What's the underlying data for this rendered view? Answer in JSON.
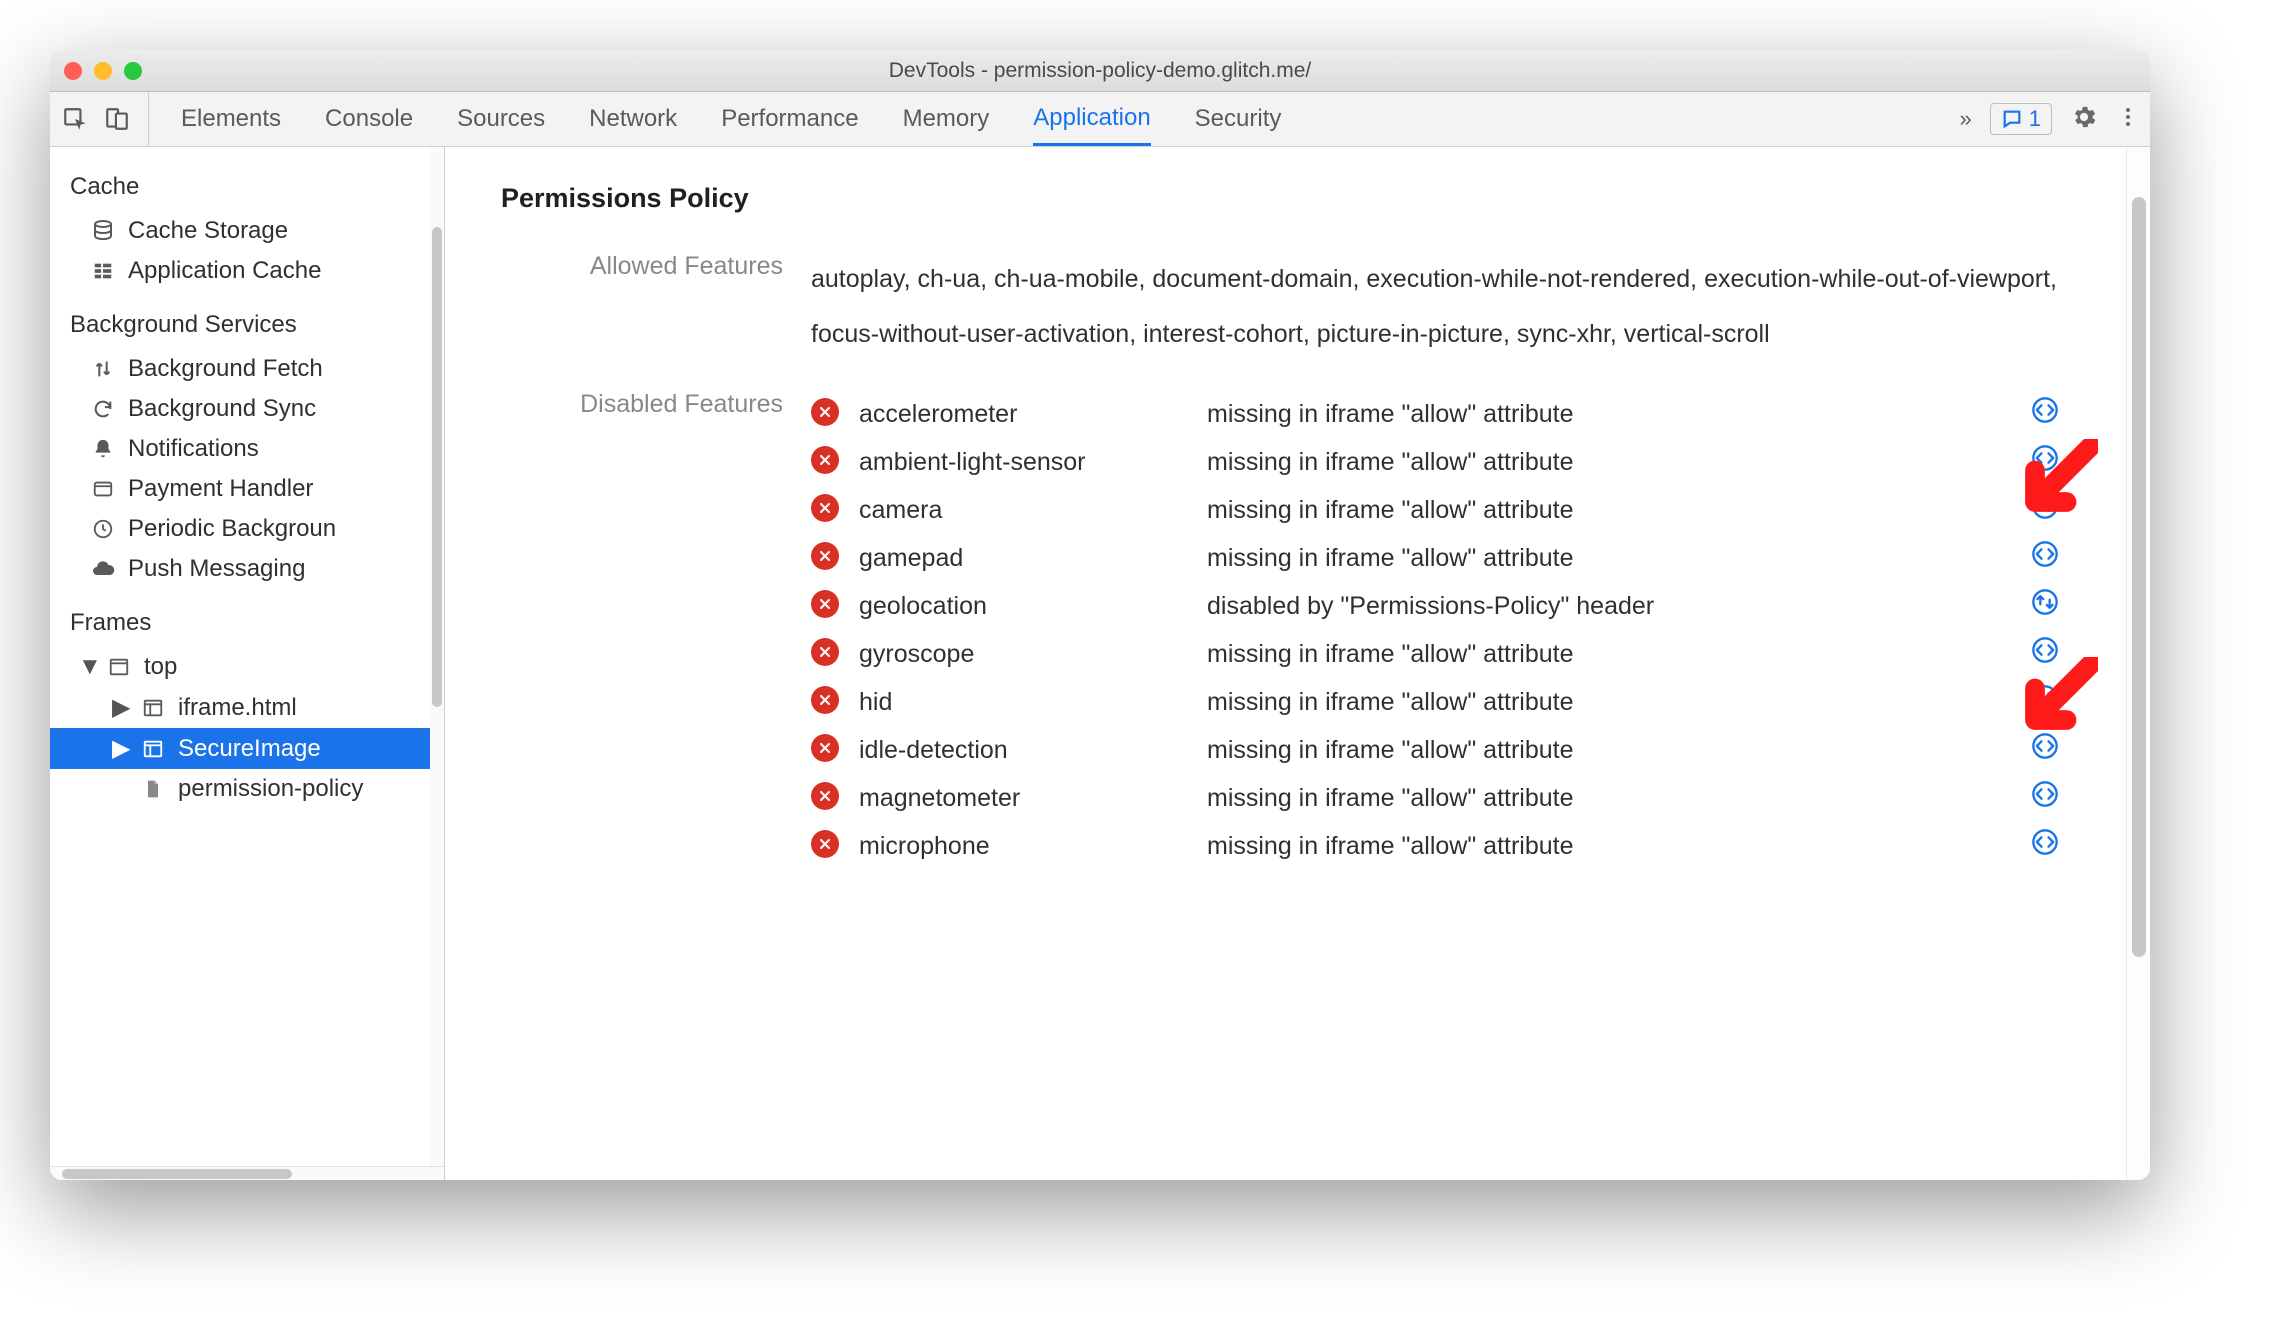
{
  "window": {
    "title": "DevTools - permission-policy-demo.glitch.me/"
  },
  "toolbar": {
    "tabs": [
      "Elements",
      "Console",
      "Sources",
      "Network",
      "Performance",
      "Memory",
      "Application",
      "Security"
    ],
    "active_tab": "Application",
    "more_label": "»",
    "issues_count": "1"
  },
  "sidebar": {
    "sections": [
      {
        "title": "Cache",
        "items": [
          {
            "icon": "database",
            "label": "Cache Storage"
          },
          {
            "icon": "grid",
            "label": "Application Cache"
          }
        ]
      },
      {
        "title": "Background Services",
        "items": [
          {
            "icon": "updown",
            "label": "Background Fetch"
          },
          {
            "icon": "sync",
            "label": "Background Sync"
          },
          {
            "icon": "bell",
            "label": "Notifications"
          },
          {
            "icon": "card",
            "label": "Payment Handler"
          },
          {
            "icon": "clock",
            "label": "Periodic Backgroun"
          },
          {
            "icon": "cloud",
            "label": "Push Messaging"
          }
        ]
      },
      {
        "title": "Frames",
        "tree": {
          "label": "top",
          "children": [
            {
              "icon": "frame",
              "label": "iframe.html"
            },
            {
              "icon": "frame",
              "label": "SecureImage",
              "selected": true
            },
            {
              "icon": "file",
              "label": "permission-policy"
            }
          ]
        }
      }
    ]
  },
  "main": {
    "title": "Permissions Policy",
    "allowed_label": "Allowed Features",
    "allowed_text": "autoplay, ch-ua, ch-ua-mobile, document-domain, execution-while-not-rendered, execution-while-out-of-viewport, focus-without-user-activation, interest-cohort, picture-in-picture, sync-xhr, vertical-scroll",
    "disabled_label": "Disabled Features",
    "disabled": [
      {
        "feature": "accelerometer",
        "reason": "missing in iframe \"allow\" attribute",
        "link": "code"
      },
      {
        "feature": "ambient-light-sensor",
        "reason": "missing in iframe \"allow\" attribute",
        "link": "code"
      },
      {
        "feature": "camera",
        "reason": "missing in iframe \"allow\" attribute",
        "link": "code"
      },
      {
        "feature": "gamepad",
        "reason": "missing in iframe \"allow\" attribute",
        "link": "code"
      },
      {
        "feature": "geolocation",
        "reason": "disabled by \"Permissions-Policy\" header",
        "link": "net"
      },
      {
        "feature": "gyroscope",
        "reason": "missing in iframe \"allow\" attribute",
        "link": "code"
      },
      {
        "feature": "hid",
        "reason": "missing in iframe \"allow\" attribute",
        "link": "code"
      },
      {
        "feature": "idle-detection",
        "reason": "missing in iframe \"allow\" attribute",
        "link": "code"
      },
      {
        "feature": "magnetometer",
        "reason": "missing in iframe \"allow\" attribute",
        "link": "code"
      },
      {
        "feature": "microphone",
        "reason": "missing in iframe \"allow\" attribute",
        "link": "code"
      }
    ]
  }
}
